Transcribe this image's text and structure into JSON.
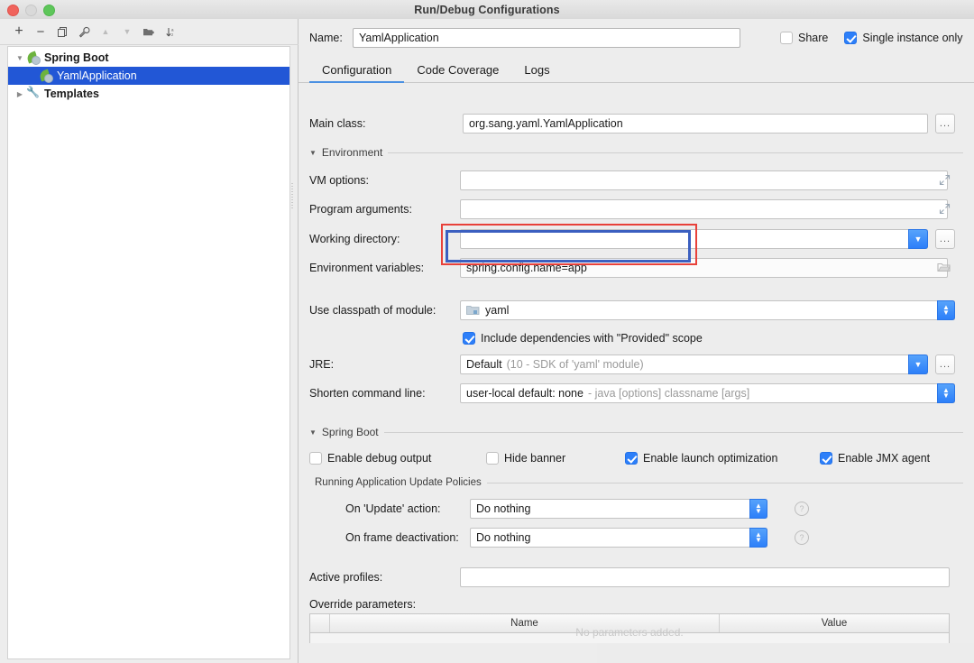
{
  "window": {
    "title": "Run/Debug Configurations",
    "traffic_lights": [
      "close-button",
      "minimize-button",
      "maximize-button"
    ]
  },
  "sidebar": {
    "toolbar": [
      {
        "name": "add-configuration-button",
        "glyph": "+",
        "enabled": true
      },
      {
        "name": "remove-configuration-button",
        "glyph": "−",
        "enabled": true
      },
      {
        "name": "copy-configuration-button",
        "glyph": "❐",
        "enabled": true
      },
      {
        "name": "edit-templates-button",
        "glyph": "🔧",
        "enabled": true
      },
      {
        "name": "move-up-button",
        "glyph": "▲",
        "enabled": false
      },
      {
        "name": "move-down-button",
        "glyph": "▼",
        "enabled": false
      },
      {
        "name": "new-folder-button",
        "glyph": "📁",
        "enabled": true
      },
      {
        "name": "sort-configurations-button",
        "glyph": "↓",
        "enabled": true
      }
    ],
    "tree": [
      {
        "label": "Spring Boot",
        "icon": "spring-boot-icon",
        "expanded": true,
        "selected": false,
        "depth": 0
      },
      {
        "label": "YamlApplication",
        "icon": "spring-boot-icon",
        "expanded": null,
        "selected": true,
        "depth": 1
      },
      {
        "label": "Templates",
        "icon": "wrench-icon",
        "expanded": false,
        "selected": false,
        "depth": 0
      }
    ]
  },
  "header": {
    "name_label": "Name:",
    "name_value": "YamlApplication",
    "share_label": "Share",
    "share_checked": false,
    "single_instance_label": "Single instance only",
    "single_instance_checked": true
  },
  "tabs": [
    {
      "label": "Configuration",
      "active": true
    },
    {
      "label": "Code Coverage",
      "active": false
    },
    {
      "label": "Logs",
      "active": false
    }
  ],
  "form": {
    "main_class_label": "Main class:",
    "main_class_value": "org.sang.yaml.YamlApplication",
    "browse_glyph": "...",
    "environment_section": "Environment",
    "vm_options_label": "VM options:",
    "vm_options_value": "",
    "program_arguments_label": "Program arguments:",
    "program_arguments_value": "",
    "working_directory_label": "Working directory:",
    "working_directory_value": "",
    "environment_variables_label": "Environment variables:",
    "environment_variables_value": "spring.config.name=app",
    "classpath_label": "Use classpath of module:",
    "classpath_value": "yaml",
    "include_provided_label": "Include dependencies with \"Provided\" scope",
    "include_provided_checked": true,
    "jre_label": "JRE:",
    "jre_value": "Default",
    "jre_value_muted": "(10 - SDK of 'yaml' module)",
    "shorten_label": "Shorten command line:",
    "shorten_value": "user-local default: none",
    "shorten_value_muted": "- java [options] classname [args]"
  },
  "spring_boot": {
    "section_title": "Spring Boot",
    "checkboxes": [
      {
        "label": "Enable debug output",
        "checked": false
      },
      {
        "label": "Hide banner",
        "checked": false
      },
      {
        "label": "Enable launch optimization",
        "checked": true
      },
      {
        "label": "Enable JMX agent",
        "checked": true
      }
    ],
    "update_policies_title": "Running Application Update Policies",
    "on_update_label": "On 'Update' action:",
    "on_update_value": "Do nothing",
    "on_frame_label": "On frame deactivation:",
    "on_frame_value": "Do nothing",
    "help_glyph": "?"
  },
  "profiles": {
    "active_profiles_label": "Active profiles:",
    "active_profiles_value": "",
    "override_parameters_label": "Override parameters:",
    "table_headers": [
      "Name",
      "Value"
    ],
    "table_empty_message": "No parameters added.",
    "table_toolbar": [
      {
        "name": "add-parameter-button",
        "glyph": "+",
        "enabled": true
      },
      {
        "name": "remove-parameter-button",
        "glyph": "−",
        "enabled": false
      },
      {
        "name": "move-parameter-up-button",
        "glyph": "▲",
        "enabled": false
      },
      {
        "name": "move-parameter-down-button",
        "glyph": "▼",
        "enabled": false
      }
    ]
  },
  "annotations": [
    {
      "name": "highlight-rect-red",
      "color": "#e8413a"
    },
    {
      "name": "highlight-rect-blue",
      "color": "#3b5fc0"
    }
  ]
}
